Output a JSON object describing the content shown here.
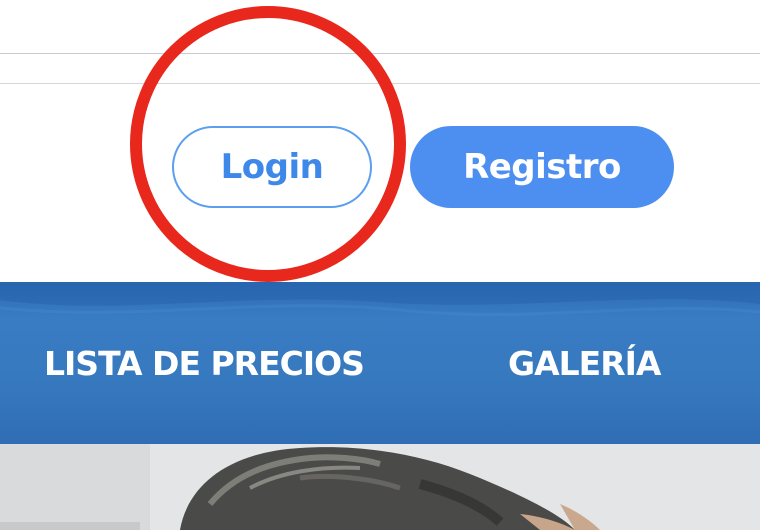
{
  "header": {
    "login_label": "Login",
    "register_label": "Registro"
  },
  "nav": {
    "items": [
      {
        "label": "LISTA DE PRECIOS"
      },
      {
        "label": "GALERÍA"
      }
    ]
  },
  "colors": {
    "accent": "#4d8ff0",
    "login_text": "#3e88e9",
    "nav_background": "#3779bf",
    "highlight_ring": "#e8281c"
  },
  "photo": {
    "subject": "person-photo"
  }
}
